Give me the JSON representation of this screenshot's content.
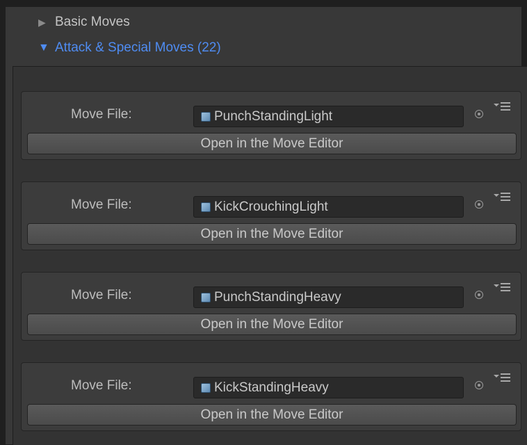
{
  "foldouts": {
    "basic": {
      "label": "Basic Moves",
      "arrow": "▶",
      "expanded": false
    },
    "attack": {
      "label": "Attack & Special Moves (22)",
      "arrow": "▼",
      "expanded": true
    }
  },
  "colors": {
    "foldout_active": "#4f8cf2",
    "panel": "#383838",
    "card": "#3c3c3c"
  },
  "moves": [
    {
      "field_label": "Move File:",
      "file": "PunchStandingLight",
      "button": "Open in the Move Editor"
    },
    {
      "field_label": "Move File:",
      "file": "KickCrouchingLight",
      "button": "Open in the Move Editor"
    },
    {
      "field_label": "Move File:",
      "file": "PunchStandingHeavy",
      "button": "Open in the Move Editor"
    },
    {
      "field_label": "Move File:",
      "file": "KickStandingHeavy",
      "button": "Open in the Move Editor"
    }
  ]
}
